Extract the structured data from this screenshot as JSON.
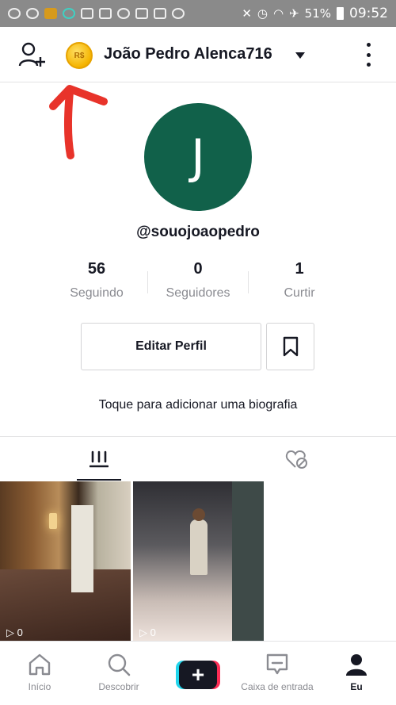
{
  "status_bar": {
    "battery": "51%",
    "time": "09:52"
  },
  "header": {
    "coin_label": "R$",
    "username": "João Pedro Alenca716"
  },
  "profile": {
    "avatar_letter": "J",
    "handle": "@souojoaopedro",
    "stats": [
      {
        "value": "56",
        "label": "Seguindo"
      },
      {
        "value": "0",
        "label": "Seguidores"
      },
      {
        "value": "1",
        "label": "Curtir"
      }
    ],
    "edit_button": "Editar Perfil",
    "bio_prompt": "Toque para adicionar uma biografia"
  },
  "videos": [
    {
      "views": "0"
    },
    {
      "views": "0"
    }
  ],
  "bottom_nav": [
    {
      "label": "Início",
      "icon": "home-icon"
    },
    {
      "label": "Descobrir",
      "icon": "search-icon"
    },
    {
      "label": "",
      "icon": "plus-icon"
    },
    {
      "label": "Caixa de entrada",
      "icon": "inbox-icon"
    },
    {
      "label": "Eu",
      "icon": "profile-icon"
    }
  ],
  "colors": {
    "avatar_bg": "#11614a",
    "annotation_arrow": "#e8332a",
    "primary_text": "#161823",
    "secondary_text": "#8a8b91",
    "accent_pink": "#fe2c55",
    "accent_cyan": "#20d5ec"
  }
}
